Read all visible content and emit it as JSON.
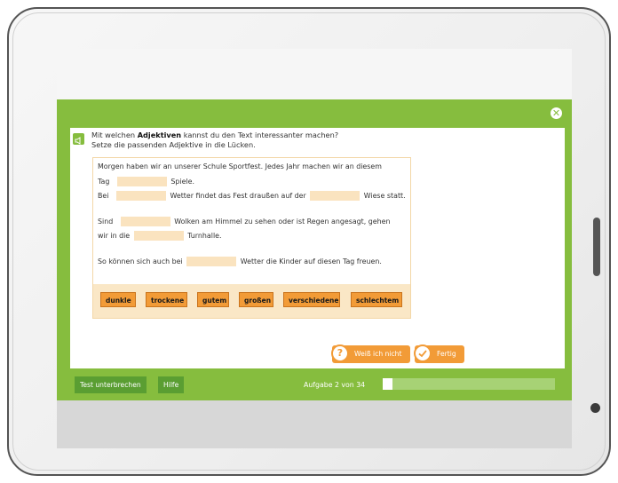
{
  "task": {
    "instruction_prefix": "Mit welchen ",
    "instruction_bold": "Adjektiven",
    "instruction_suffix": " kannst du den Text interessanter machen?",
    "instruction_line2": "Setze die passenden Adjektive in die Lücken."
  },
  "text": {
    "l1": "Morgen haben wir an unserer Schule Sportfest. Jedes Jahr machen wir an diesem",
    "l2a": "Tag",
    "l2b": "Spiele.",
    "l3a": "Bei",
    "l3b": "Wetter findet das Fest draußen auf der",
    "l3c": "Wiese statt.",
    "l4a": "Sind",
    "l4b": "Wolken am Himmel zu sehen oder ist Regen angesagt, gehen",
    "l5a": "wir in die",
    "l5b": "Turnhalle.",
    "l6a": "So können sich auch bei",
    "l6b": "Wetter die Kinder auf diesen Tag freuen."
  },
  "word_bank": [
    "dunkle",
    "trockene",
    "gutem",
    "großen",
    "verschiedene",
    "schlechtem"
  ],
  "buttons": {
    "dont_know": "Weiß ich nicht",
    "done": "Fertig",
    "interrupt": "Test unterbrechen",
    "help": "Hilfe"
  },
  "progress": {
    "label": "Aufgabe 2 von 34",
    "current": 2,
    "total": 34
  },
  "icons": {
    "speaker": "speaker-icon",
    "close": "close-icon",
    "question": "question-icon",
    "check": "check-icon"
  },
  "colors": {
    "panel_green": "#86bd3e",
    "accent_orange": "#f29b37",
    "gap_fill": "#fae3bf"
  }
}
